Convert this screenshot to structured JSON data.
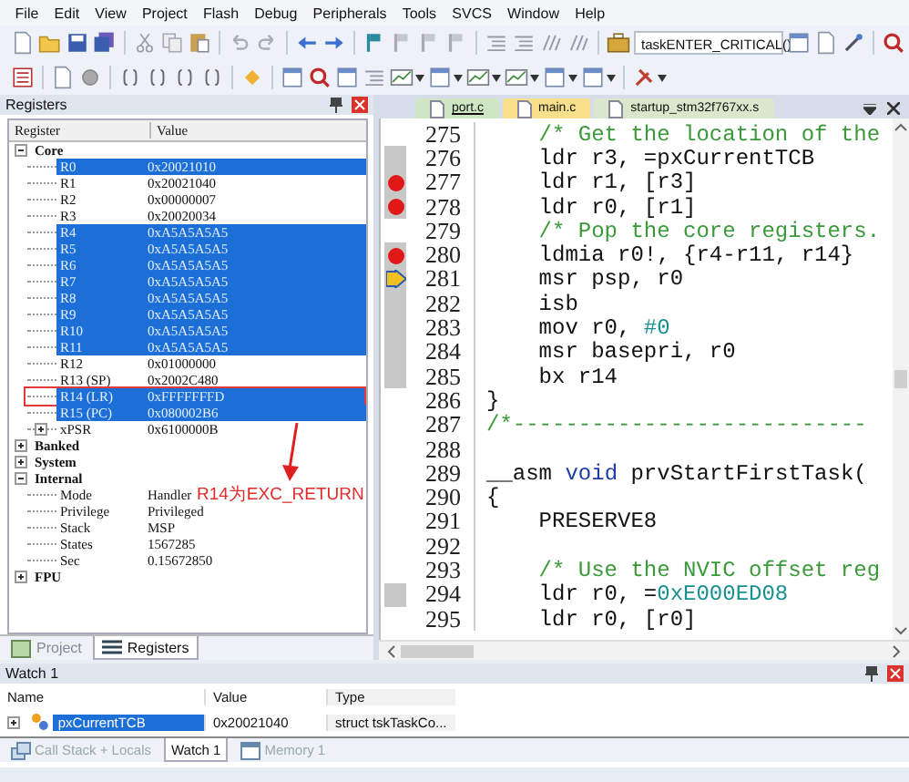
{
  "menu": [
    "File",
    "Edit",
    "View",
    "Project",
    "Flash",
    "Debug",
    "Peripherals",
    "Tools",
    "SVCS",
    "Window",
    "Help"
  ],
  "toolbar": {
    "find_combo": "taskENTER_CRITICAL()"
  },
  "registers_panel": {
    "title": "Registers",
    "columns": [
      "Register",
      "Value"
    ],
    "tree": [
      {
        "name": "Core",
        "expanded": true,
        "children": [
          {
            "name": "R0",
            "value": "0x20021010",
            "selected": true
          },
          {
            "name": "R1",
            "value": "0x20021040",
            "selected": false
          },
          {
            "name": "R2",
            "value": "0x00000007",
            "selected": false
          },
          {
            "name": "R3",
            "value": "0x20020034",
            "selected": false
          },
          {
            "name": "R4",
            "value": "0xA5A5A5A5",
            "selected": true
          },
          {
            "name": "R5",
            "value": "0xA5A5A5A5",
            "selected": true
          },
          {
            "name": "R6",
            "value": "0xA5A5A5A5",
            "selected": true
          },
          {
            "name": "R7",
            "value": "0xA5A5A5A5",
            "selected": true
          },
          {
            "name": "R8",
            "value": "0xA5A5A5A5",
            "selected": true
          },
          {
            "name": "R9",
            "value": "0xA5A5A5A5",
            "selected": true
          },
          {
            "name": "R10",
            "value": "0xA5A5A5A5",
            "selected": true
          },
          {
            "name": "R11",
            "value": "0xA5A5A5A5",
            "selected": true
          },
          {
            "name": "R12",
            "value": "0x01000000",
            "selected": false
          },
          {
            "name": "R13 (SP)",
            "value": "0x2002C480",
            "selected": false
          },
          {
            "name": "R14 (LR)",
            "value": "0xFFFFFFFD",
            "selected": true,
            "marked": true
          },
          {
            "name": "R15 (PC)",
            "value": "0x080002B6",
            "selected": true
          },
          {
            "name": "xPSR",
            "value": "0x6100000B",
            "selected": false,
            "expanded": false
          }
        ]
      },
      {
        "name": "Banked",
        "expanded": false
      },
      {
        "name": "System",
        "expanded": false
      },
      {
        "name": "Internal",
        "expanded": true,
        "children": [
          {
            "name": "Mode",
            "value": "Handler",
            "selected": false
          },
          {
            "name": "Privilege",
            "value": "Privileged",
            "selected": false
          },
          {
            "name": "Stack",
            "value": "MSP",
            "selected": false
          },
          {
            "name": "States",
            "value": "1567285",
            "selected": false
          },
          {
            "name": "Sec",
            "value": "0.15672850",
            "selected": false
          }
        ]
      },
      {
        "name": "FPU",
        "expanded": false
      }
    ],
    "annotation": "R14为EXC_RETURN",
    "tabs": [
      {
        "label": "Project",
        "selected": false
      },
      {
        "label": "Registers",
        "selected": true
      }
    ]
  },
  "editor": {
    "tabs": [
      {
        "label": "port.c",
        "selected": true,
        "color": "#cfe6c4"
      },
      {
        "label": "main.c",
        "selected": false,
        "color": "#f7df8c"
      },
      {
        "label": "startup_stm32f767xx.s",
        "selected": false,
        "color": "#d9e8cc"
      }
    ],
    "lines": [
      {
        "number": "275",
        "covered": false,
        "breakpoint": false,
        "current": false,
        "tokens": [
          {
            "kind": "comment",
            "text": "    /* Get the location of the"
          }
        ]
      },
      {
        "number": "276",
        "covered": true,
        "breakpoint": false,
        "current": false,
        "tokens": [
          {
            "kind": "plain",
            "text": "    ldr r3, =pxCurrentTCB"
          }
        ]
      },
      {
        "number": "277",
        "covered": true,
        "breakpoint": true,
        "current": false,
        "tokens": [
          {
            "kind": "plain",
            "text": "    ldr r1, [r3]"
          }
        ]
      },
      {
        "number": "278",
        "covered": true,
        "breakpoint": true,
        "current": false,
        "tokens": [
          {
            "kind": "plain",
            "text": "    ldr r0, [r1]"
          }
        ]
      },
      {
        "number": "279",
        "covered": false,
        "breakpoint": false,
        "current": false,
        "tokens": [
          {
            "kind": "comment",
            "text": "    /* Pop the core registers."
          }
        ]
      },
      {
        "number": "280",
        "covered": true,
        "breakpoint": true,
        "current": false,
        "tokens": [
          {
            "kind": "plain",
            "text": "    ldmia r0!, {r4-r11, r14}"
          }
        ]
      },
      {
        "number": "281",
        "covered": true,
        "breakpoint": false,
        "current": true,
        "tokens": [
          {
            "kind": "plain",
            "text": "    msr psp, r0"
          }
        ]
      },
      {
        "number": "282",
        "covered": true,
        "breakpoint": false,
        "current": false,
        "tokens": [
          {
            "kind": "plain",
            "text": "    isb"
          }
        ]
      },
      {
        "number": "283",
        "covered": true,
        "breakpoint": false,
        "current": false,
        "tokens": [
          {
            "kind": "plain",
            "text": "    mov r0, "
          },
          {
            "kind": "number",
            "text": "#0"
          }
        ]
      },
      {
        "number": "284",
        "covered": true,
        "breakpoint": false,
        "current": false,
        "tokens": [
          {
            "kind": "plain",
            "text": "    msr basepri, r0"
          }
        ]
      },
      {
        "number": "285",
        "covered": true,
        "breakpoint": false,
        "current": false,
        "tokens": [
          {
            "kind": "plain",
            "text": "    bx r14"
          }
        ]
      },
      {
        "number": "286",
        "covered": false,
        "breakpoint": false,
        "current": false,
        "tokens": [
          {
            "kind": "plain",
            "text": "}"
          }
        ]
      },
      {
        "number": "287",
        "covered": false,
        "breakpoint": false,
        "current": false,
        "tokens": [
          {
            "kind": "comment",
            "text": "/*---------------------------"
          }
        ]
      },
      {
        "number": "288",
        "covered": false,
        "breakpoint": false,
        "current": false
      },
      {
        "number": "289",
        "covered": false,
        "breakpoint": false,
        "current": false,
        "tokens": [
          {
            "kind": "plain",
            "text": "__asm "
          },
          {
            "kind": "keyword",
            "text": "void"
          },
          {
            "kind": "plain",
            "text": " prvStartFirstTask("
          }
        ]
      },
      {
        "number": "290",
        "covered": false,
        "breakpoint": false,
        "current": false,
        "tokens": [
          {
            "kind": "plain",
            "text": "{"
          }
        ]
      },
      {
        "number": "291",
        "covered": false,
        "breakpoint": false,
        "current": false,
        "tokens": [
          {
            "kind": "plain",
            "text": "    PRESERVE8"
          }
        ]
      },
      {
        "number": "292",
        "covered": false,
        "breakpoint": false,
        "current": false
      },
      {
        "number": "293",
        "covered": false,
        "breakpoint": false,
        "current": false,
        "tokens": [
          {
            "kind": "comment",
            "text": "    /* Use the NVIC offset reg"
          }
        ]
      },
      {
        "number": "294",
        "covered": true,
        "breakpoint": false,
        "current": false,
        "tokens": [
          {
            "kind": "plain",
            "text": "    ldr r0, ="
          },
          {
            "kind": "number",
            "text": "0xE000ED08"
          }
        ]
      },
      {
        "number": "295",
        "covered": false,
        "breakpoint": false,
        "current": false,
        "tokens": [
          {
            "kind": "plain",
            "text": "    ldr r0, [r0]"
          }
        ]
      }
    ]
  },
  "watch_panel": {
    "title": "Watch 1",
    "columns": [
      "Name",
      "Value",
      "Type"
    ],
    "rows": [
      {
        "name": "pxCurrentTCB",
        "value": "0x20021040",
        "type": "struct tskTaskCo...",
        "selected": true,
        "expanded": false
      }
    ],
    "tabs": [
      {
        "label": "Call Stack + Locals",
        "selected": false
      },
      {
        "label": "Watch 1",
        "selected": true
      },
      {
        "label": "Memory 1",
        "selected": false
      }
    ]
  }
}
